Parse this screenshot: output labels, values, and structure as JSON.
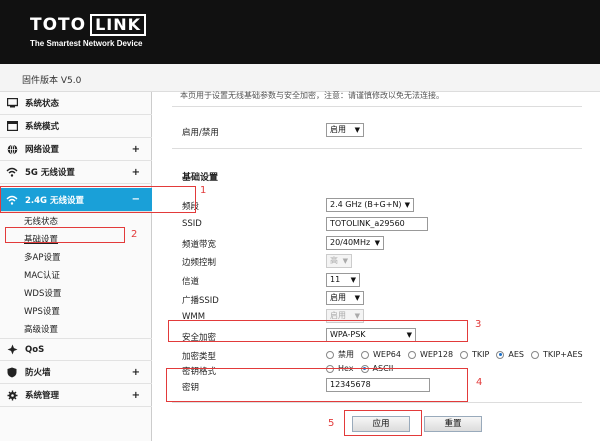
{
  "brand": {
    "logo_left": "TOTO",
    "logo_right": "LINK",
    "tagline": "The Smartest Network Device"
  },
  "firmware": {
    "label": "固件版本 V5.0"
  },
  "sidebar": {
    "items": [
      {
        "label": "系统状态",
        "icon": "monitor-icon"
      },
      {
        "label": "系统模式",
        "icon": "window-icon"
      },
      {
        "label": "网络设置",
        "icon": "globe-icon",
        "expand": "+"
      },
      {
        "label": "5G 无线设置",
        "icon": "wifi-icon",
        "expand": "+"
      },
      {
        "label": "2.4G 无线设置",
        "icon": "wifi-icon",
        "expand": "−"
      }
    ],
    "subitems": [
      "无线状态",
      "基础设置",
      "多AP设置",
      "MAC认证",
      "WDS设置",
      "WPS设置",
      "高级设置"
    ],
    "bottom_items": [
      {
        "label": "QoS",
        "icon": "qos-icon"
      },
      {
        "label": "防火墙",
        "icon": "shield-icon",
        "expand": "+"
      },
      {
        "label": "系统管理",
        "icon": "gear-icon",
        "expand": "+"
      }
    ],
    "active_color": "#1aa0d8"
  },
  "main": {
    "top_cut_text": "本页用于设置无线基础参数与安全加密，注意：请谨慎修改以免无法连接。",
    "enable_label": "启用/禁用",
    "enable_value": "启用",
    "section_title": "基础设置",
    "fields": {
      "band_label": "频段",
      "band_value": "2.4 GHz (B+G+N)",
      "ssid_label": "SSID",
      "ssid_value": "TOTOLINK_a29560",
      "width_label": "频道带宽",
      "width_value": "20/40MHz",
      "sideband_label": "边频控制",
      "sideband_value": "高",
      "channel_label": "信道",
      "channel_value": "11",
      "broadcast_label": "广播SSID",
      "broadcast_value": "启用",
      "wmm_label": "WMM",
      "wmm_value": "启用",
      "security_label": "安全加密",
      "security_value": "WPA-PSK",
      "enc_label": "加密类型",
      "enc_options": [
        "禁用",
        "WEP64",
        "WEP128",
        "TKIP",
        "AES",
        "TKIP+AES"
      ],
      "enc_selected": "AES",
      "keyfmt_label": "密钥格式",
      "keyfmt_options": [
        "Hex",
        "ASCII"
      ],
      "keyfmt_selected": "ASCII",
      "key_label": "密钥",
      "key_value": "12345678"
    },
    "apply_button": "应用",
    "reset_button": "重置"
  },
  "annotations": {
    "n1": "1",
    "n2": "2",
    "n3": "3",
    "n4": "4",
    "n5": "5",
    "color": "#e23a3a"
  }
}
